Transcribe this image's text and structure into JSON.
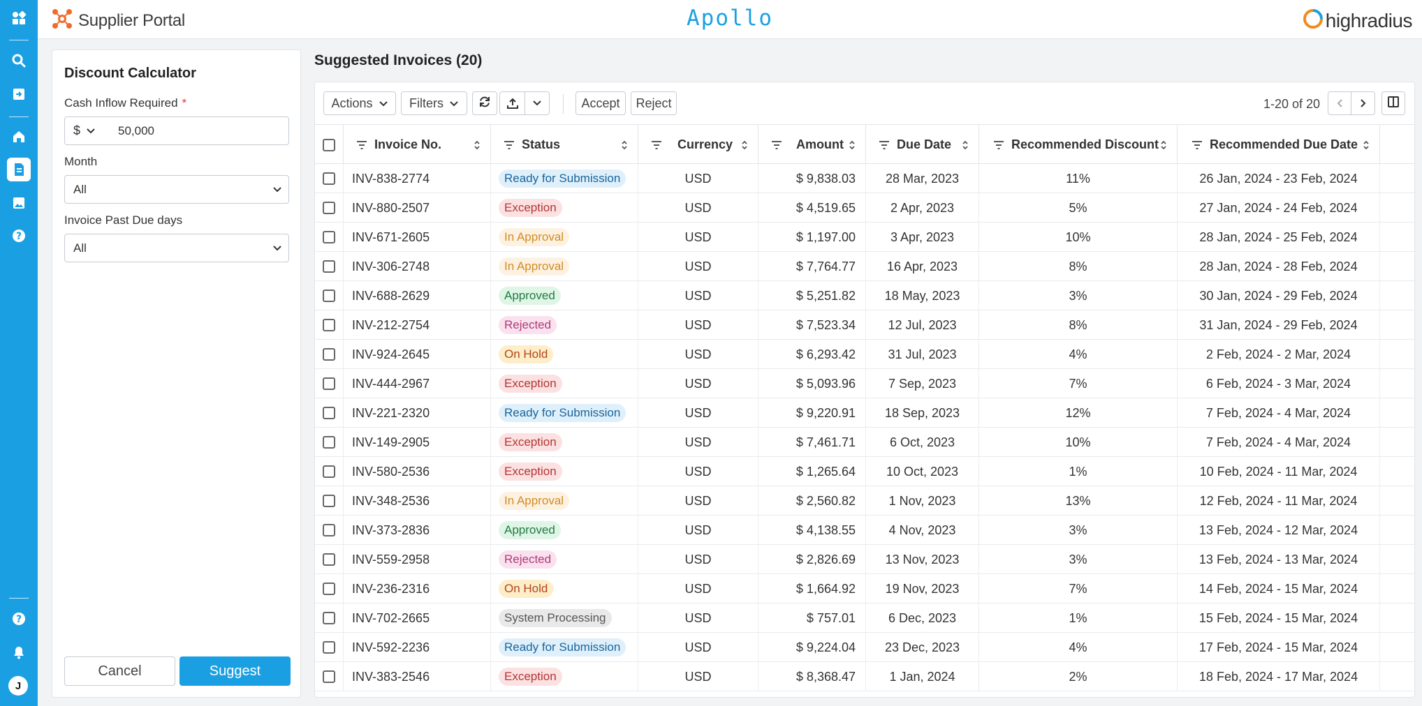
{
  "app": {
    "brand_name": "Supplier Portal",
    "product_name": "Apollo",
    "vendor_name": "highradius",
    "accent_color": "#1aa0e2"
  },
  "rail": {
    "icons": [
      "apps-icon",
      "search-icon",
      "exit-icon",
      "home-icon",
      "document-icon",
      "image-icon",
      "help-icon",
      "help-icon",
      "bell-icon"
    ],
    "avatar_initial": "J"
  },
  "calculator": {
    "title": "Discount Calculator",
    "cash_label": "Cash Inflow Required",
    "required_mark": "*",
    "currency_symbol": "$",
    "cash_value": "50,000",
    "month_label": "Month",
    "month_value": "All",
    "past_due_label": "Invoice Past Due days",
    "past_due_value": "All",
    "cancel_label": "Cancel",
    "suggest_label": "Suggest"
  },
  "invoices": {
    "title": "Suggested Invoices (20)",
    "toolbar": {
      "actions_label": "Actions",
      "filters_label": "Filters",
      "accept_label": "Accept",
      "reject_label": "Reject",
      "pagination_text": "1-20 of 20"
    },
    "columns": {
      "invoice": "Invoice No.",
      "status": "Status",
      "currency": "Currency",
      "amount": "Amount",
      "due_date": "Due Date",
      "discount": "Recommended Discount",
      "rec_due": "Recommended Due Date"
    },
    "status_styles": {
      "Ready for Submission": "st-ready",
      "Exception": "st-exc",
      "In Approval": "st-appr",
      "Approved": "st-ok",
      "Rejected": "st-rej",
      "On Hold": "st-hold",
      "System Processing": "st-sys"
    },
    "rows": [
      {
        "invoice": "INV-838-2774",
        "status": "Ready for Submission",
        "currency": "USD",
        "amount": "$ 9,838.03",
        "due": "28 Mar, 2023",
        "discount": "11%",
        "rec_due": "26 Jan, 2024 - 23 Feb, 2024"
      },
      {
        "invoice": "INV-880-2507",
        "status": "Exception",
        "currency": "USD",
        "amount": "$ 4,519.65",
        "due": "2 Apr, 2023",
        "discount": "5%",
        "rec_due": "27 Jan, 2024 - 24 Feb, 2024"
      },
      {
        "invoice": "INV-671-2605",
        "status": "In Approval",
        "currency": "USD",
        "amount": "$ 1,197.00",
        "due": "3 Apr, 2023",
        "discount": "10%",
        "rec_due": "28 Jan, 2024 - 25 Feb, 2024"
      },
      {
        "invoice": "INV-306-2748",
        "status": "In Approval",
        "currency": "USD",
        "amount": "$  7,764.77",
        "due": "16 Apr, 2023",
        "discount": "8%",
        "rec_due": "28 Jan, 2024 - 28 Feb, 2024"
      },
      {
        "invoice": "INV-688-2629",
        "status": "Approved",
        "currency": "USD",
        "amount": "$ 5,251.82",
        "due": "18 May, 2023",
        "discount": "3%",
        "rec_due": "30 Jan, 2024 - 29 Feb, 2024"
      },
      {
        "invoice": "INV-212-2754",
        "status": "Rejected",
        "currency": "USD",
        "amount": "$ 7,523.34",
        "due": "12 Jul, 2023",
        "discount": "8%",
        "rec_due": "31 Jan, 2024 - 29 Feb, 2024"
      },
      {
        "invoice": "INV-924-2645",
        "status": "On Hold",
        "currency": "USD",
        "amount": "$ 6,293.42",
        "due": "31 Jul, 2023",
        "discount": "4%",
        "rec_due": "2 Feb, 2024 - 2 Mar, 2024"
      },
      {
        "invoice": "INV-444-2967",
        "status": "Exception",
        "currency": "USD",
        "amount": "$ 5,093.96",
        "due": "7 Sep, 2023",
        "discount": "7%",
        "rec_due": "6 Feb, 2024 - 3 Mar, 2024"
      },
      {
        "invoice": "INV-221-2320",
        "status": "Ready for Submission",
        "currency": "USD",
        "amount": "$ 9,220.91",
        "due": "18 Sep, 2023",
        "discount": "12%",
        "rec_due": "7 Feb, 2024 - 4 Mar, 2024"
      },
      {
        "invoice": "INV-149-2905",
        "status": "Exception",
        "currency": "USD",
        "amount": "$ 7,461.71",
        "due": "6 Oct, 2023",
        "discount": "10%",
        "rec_due": "7 Feb, 2024 - 4 Mar, 2024"
      },
      {
        "invoice": "INV-580-2536",
        "status": "Exception",
        "currency": "USD",
        "amount": "$ 1,265.64",
        "due": "10 Oct, 2023",
        "discount": "1%",
        "rec_due": "10 Feb, 2024 - 11 Mar, 2024"
      },
      {
        "invoice": "INV-348-2536",
        "status": "In Approval",
        "currency": "USD",
        "amount": "$ 2,560.82",
        "due": "1 Nov, 2023",
        "discount": "13%",
        "rec_due": "12 Feb, 2024 - 11 Mar, 2024"
      },
      {
        "invoice": "INV-373-2836",
        "status": "Approved",
        "currency": "USD",
        "amount": "$ 4,138.55",
        "due": "4 Nov, 2023",
        "discount": "3%",
        "rec_due": "13 Feb, 2024 - 12 Mar, 2024"
      },
      {
        "invoice": "INV-559-2958",
        "status": "Rejected",
        "currency": "USD",
        "amount": "$ 2,826.69",
        "due": "13 Nov, 2023",
        "discount": "3%",
        "rec_due": "13 Feb, 2024 - 13 Mar, 2024"
      },
      {
        "invoice": "INV-236-2316",
        "status": "On Hold",
        "currency": "USD",
        "amount": "$ 1,664.92",
        "due": "19 Nov, 2023",
        "discount": "7%",
        "rec_due": "14 Feb, 2024 - 15 Mar, 2024"
      },
      {
        "invoice": "INV-702-2665",
        "status": "System Processing",
        "currency": "USD",
        "amount": "$ 757.01",
        "due": "6 Dec, 2023",
        "discount": "1%",
        "rec_due": "15 Feb, 2024 - 15 Mar, 2024"
      },
      {
        "invoice": "INV-592-2236",
        "status": "Ready for Submission",
        "currency": "USD",
        "amount": "$ 9,224.04",
        "due": "23 Dec, 2023",
        "discount": "4%",
        "rec_due": "17 Feb, 2024 - 15 Mar, 2024"
      },
      {
        "invoice": "INV-383-2546",
        "status": "Exception",
        "currency": "USD",
        "amount": "$ 8,368.47",
        "due": "1 Jan, 2024",
        "discount": "2%",
        "rec_due": "18 Feb, 2024 - 17 Mar, 2024"
      }
    ]
  }
}
